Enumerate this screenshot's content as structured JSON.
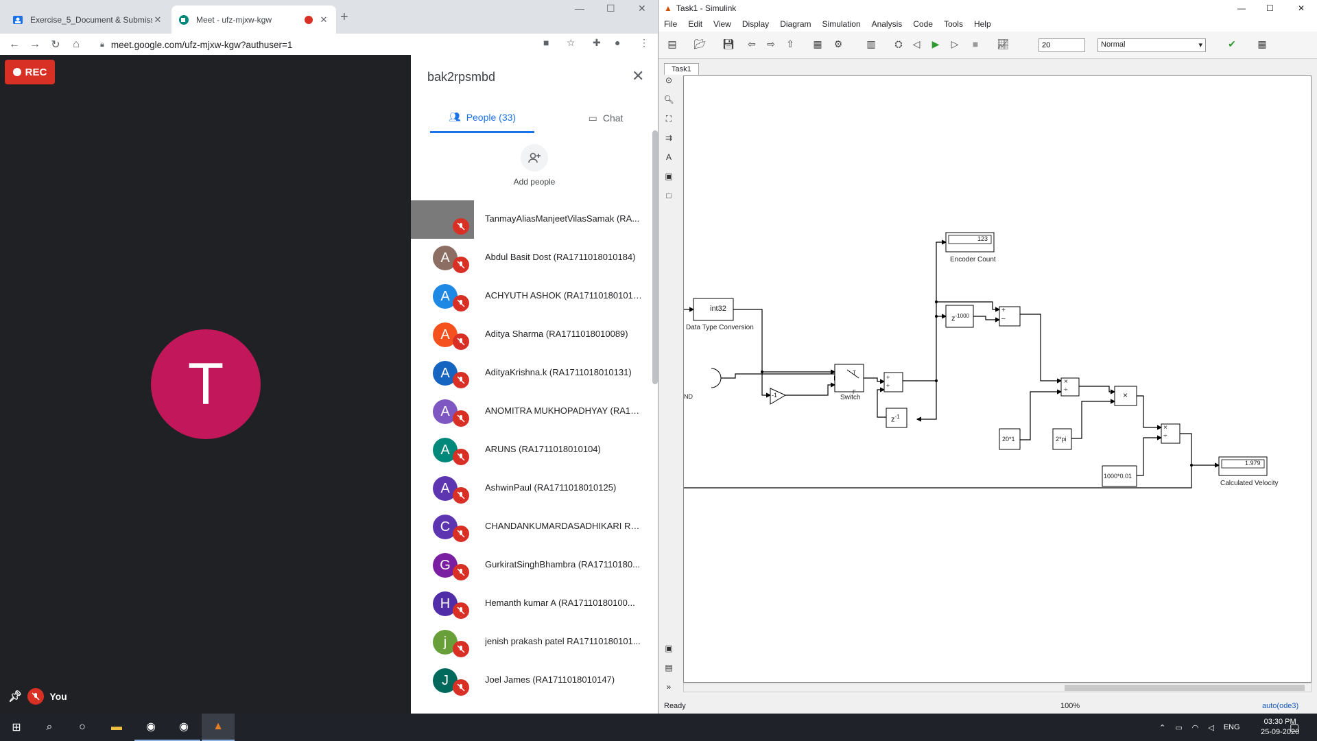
{
  "browser": {
    "tabs": [
      {
        "title": "Exercise_5_Document & Submiss"
      },
      {
        "title": "Meet - ufz-mjxw-kgw"
      }
    ],
    "url": "meet.google.com/ufz-mjxw-kgw?authuser=1"
  },
  "meet": {
    "rec_label": "REC",
    "main_avatar_letter": "T",
    "self_label": "You",
    "panel_title": "bak2rpsmbd",
    "tab_people": "People (33)",
    "tab_chat": "Chat",
    "add_people": "Add people",
    "participants": [
      {
        "initial": "",
        "name": "TanmayAliasManjeetVilasSamak (RA...",
        "color": "#7a7a7a"
      },
      {
        "initial": "A",
        "name": "Abdul Basit Dost (RA1711018010184)",
        "color": "#8d6e63"
      },
      {
        "initial": "A",
        "name": "ACHYUTH ASHOK (RA1711018010151)",
        "color": "#1e88e5"
      },
      {
        "initial": "A",
        "name": "Aditya Sharma (RA1711018010089)",
        "color": "#f4511e"
      },
      {
        "initial": "A",
        "name": "AdityaKrishna.k (RA1711018010131)",
        "color": "#1565c0"
      },
      {
        "initial": "A",
        "name": "ANOMITRA MUKHOPADHYAY (RA171...",
        "color": "#7e57c2"
      },
      {
        "initial": "A",
        "name": "ARUNS (RA1711018010104)",
        "color": "#00897b"
      },
      {
        "initial": "A",
        "name": "AshwinPaul (RA1711018010125)",
        "color": "#5e35b1"
      },
      {
        "initial": "C",
        "name": "CHANDANKUMARDASADHIKARI RA1...",
        "color": "#5e35b1"
      },
      {
        "initial": "G",
        "name": "GurkiratSinghBhambra (RA17110180...",
        "color": "#7b1fa2"
      },
      {
        "initial": "H",
        "name": "Hemanth kumar A (RA17110180100...",
        "color": "#512da8"
      },
      {
        "initial": "j",
        "name": "jenish prakash patel RA17110180101...",
        "color": "#689f38"
      },
      {
        "initial": "J",
        "name": "Joel James (RA1711018010147)",
        "color": "#00695c"
      }
    ]
  },
  "simulink": {
    "title": "Task1 - Simulink",
    "menu": [
      "File",
      "Edit",
      "View",
      "Display",
      "Diagram",
      "Simulation",
      "Analysis",
      "Code",
      "Tools",
      "Help"
    ],
    "stop_time": "20",
    "mode": "Normal",
    "tab": "Task1",
    "status_left": "Ready",
    "status_zoom": "100%",
    "status_solver": "auto(ode3)",
    "blocks": {
      "int32": "int32",
      "dtc_label": "Data Type Conversion",
      "enc_val": "123",
      "enc_label": "Encoder Count",
      "delay1000": "z",
      "delay1000_sup": "-1000",
      "switch_label": "Switch",
      "gain": "-1",
      "zinv": "z",
      "zinv_sup": "-1",
      "c1": "20*1",
      "c2": "2*pi",
      "c3": "1000*0.01",
      "vel_val": "1.979",
      "vel_label": "Calculated Velocity",
      "nd": "ND"
    }
  },
  "taskbar": {
    "lang": "ENG",
    "time": "03:30 PM",
    "date": "25-09-2020"
  }
}
